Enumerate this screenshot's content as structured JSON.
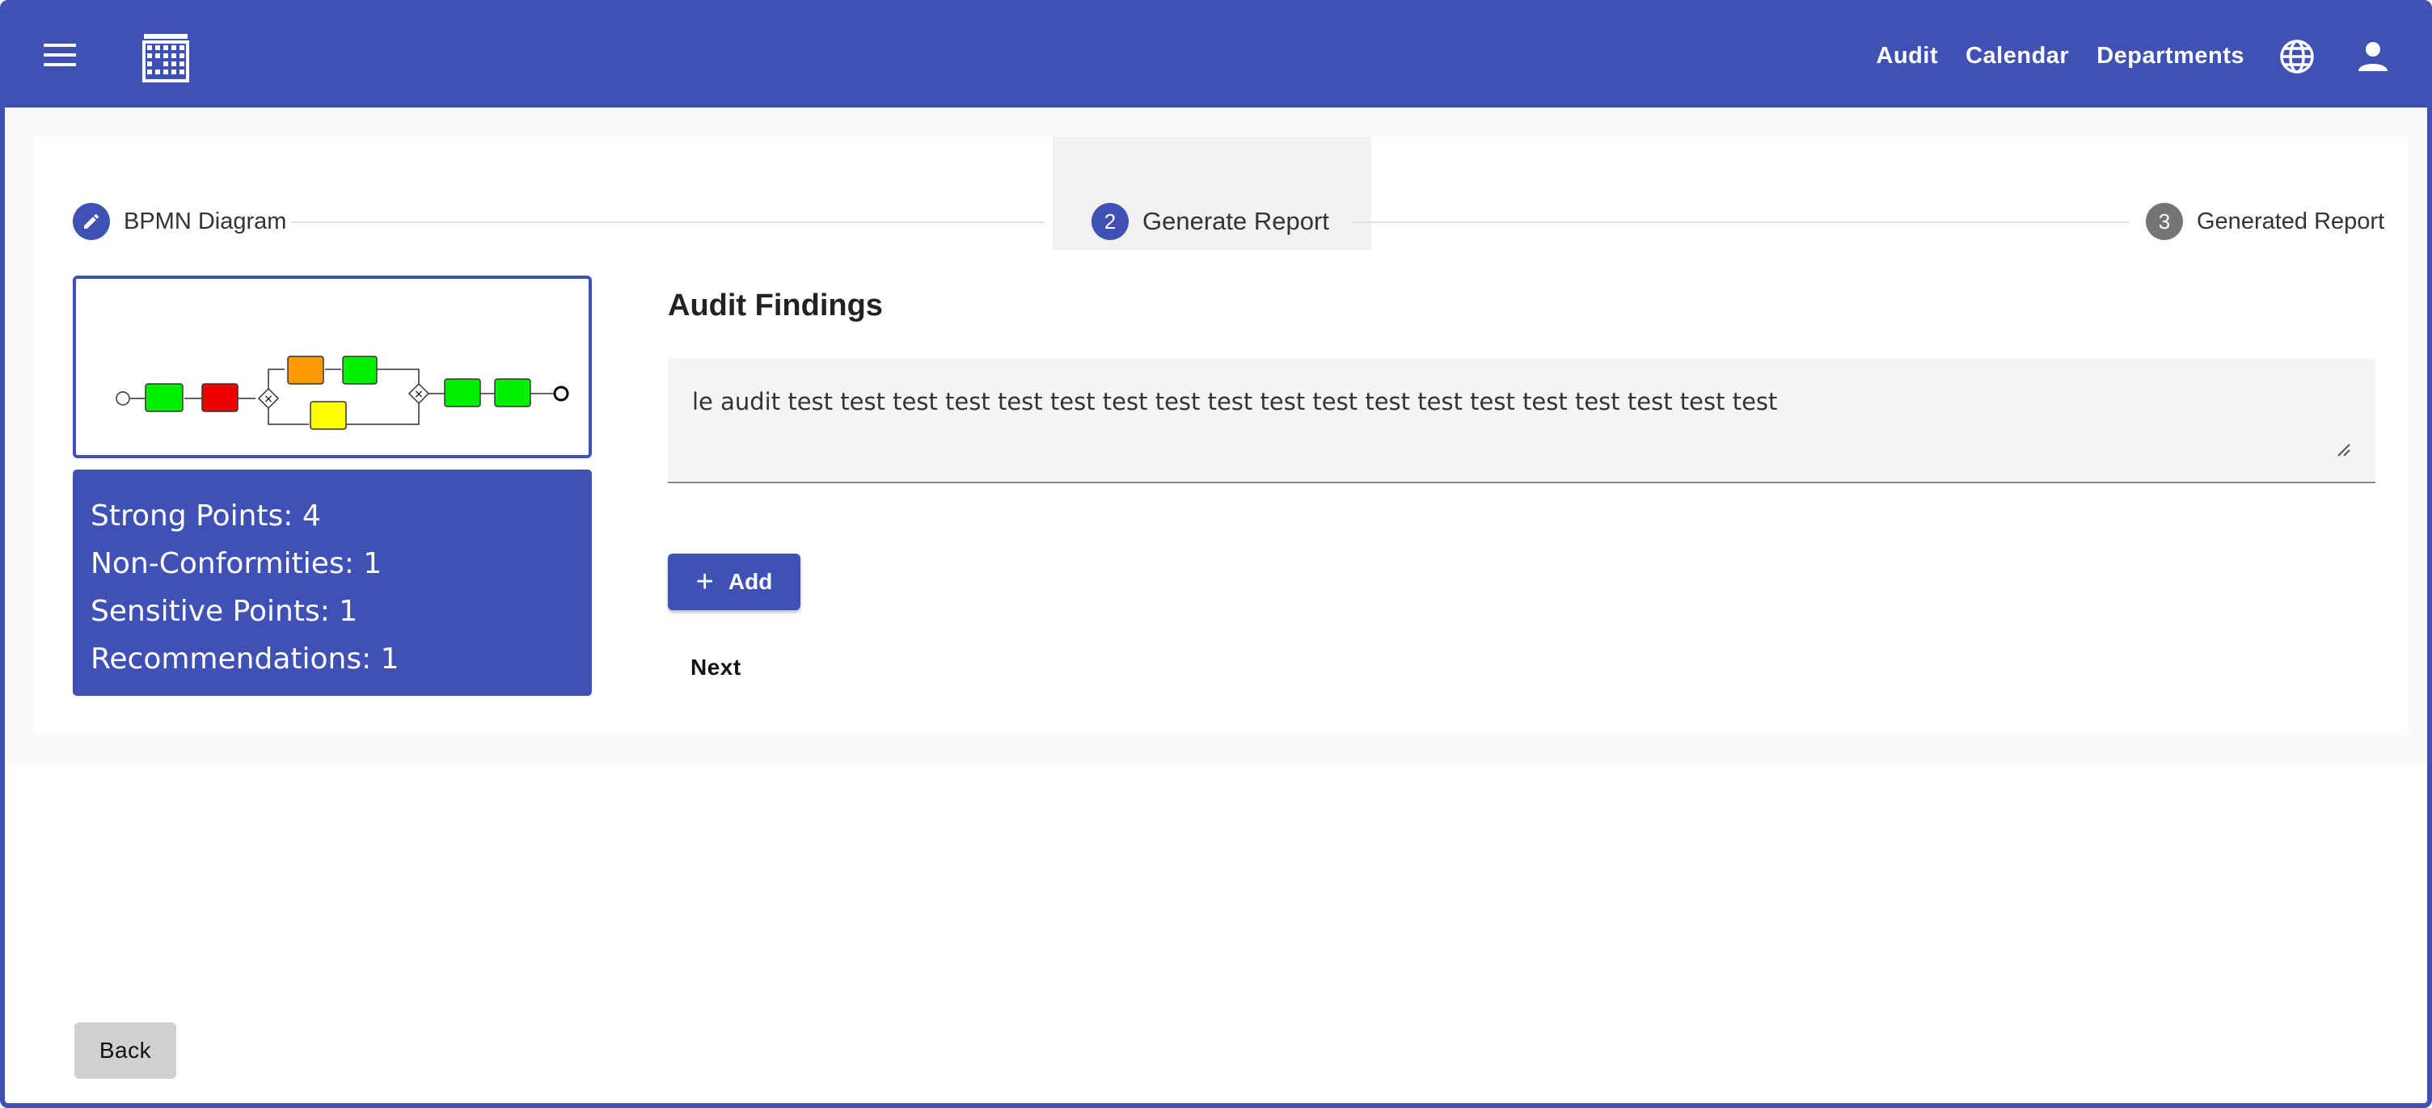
{
  "header": {
    "nav": [
      "Audit",
      "Calendar",
      "Departments"
    ],
    "icons": {
      "menu": "hamburger-icon",
      "logo": "building-icon",
      "language": "globe-icon",
      "account": "person-icon"
    }
  },
  "stepper": {
    "steps": [
      {
        "label": "BPMN Diagram",
        "state": "completed",
        "icon": "pencil-icon"
      },
      {
        "label": "Generate Report",
        "number": "2",
        "state": "active"
      },
      {
        "label": "Generated Report",
        "number": "3",
        "state": "pending"
      }
    ]
  },
  "stats": {
    "strong": "Strong Points: 4",
    "nonconf": "Non-Conformities: 1",
    "sensitive": "Sensitive Points: 1",
    "recommendations": "Recommendations: 1"
  },
  "findings": {
    "title": "Audit Findings",
    "text": "le audit test test  test test test test test test test test test test test test test test test test test"
  },
  "buttons": {
    "add": "Add",
    "next": "Next",
    "back": "Back"
  },
  "colors": {
    "primary": "#3f51b5",
    "diagram_green": "#00ee00",
    "diagram_red": "#ee0000",
    "diagram_orange": "#ff9900",
    "diagram_yellow": "#ffff00",
    "pending_step": "#757575"
  }
}
